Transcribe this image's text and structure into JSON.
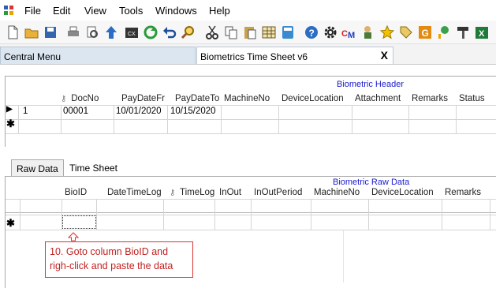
{
  "menu": [
    "File",
    "Edit",
    "View",
    "Tools",
    "Windows",
    "Help"
  ],
  "toolbar_icons": [
    "new-document-icon",
    "open-folder-icon",
    "save-icon",
    "print-icon",
    "print-preview-icon",
    "upload-icon",
    "console-icon",
    "refresh-icon",
    "undo-icon",
    "search-tool-icon",
    "cut-icon",
    "copy-icon",
    "paste-icon",
    "grid-icon",
    "calculator-icon",
    "help-icon",
    "settings-icon",
    "cm-icon",
    "user-icon",
    "star-icon",
    "tag-icon",
    "g-icon",
    "chart-icon",
    "brush-icon",
    "excel-icon"
  ],
  "doc_tabs": {
    "central": "Central Menu",
    "biometrics": "Biometrics Time Sheet v6",
    "close": "X"
  },
  "header_grid": {
    "caption": "Biometric Header",
    "columns": [
      "DocNo",
      "PayDateFr",
      "PayDateTo",
      "MachineNo",
      "DeviceLocation",
      "Attachment",
      "Remarks",
      "Status"
    ],
    "rows": [
      {
        "num": "1",
        "docno": "00001",
        "paydatefr": "10/01/2020",
        "paydateto": "10/15/2020"
      }
    ]
  },
  "sub_tabs": {
    "raw": "Raw Data",
    "time": "Time Sheet"
  },
  "raw_grid": {
    "caption": "Biometric Raw Data",
    "columns": [
      "BioID",
      "DateTimeLog",
      "TimeLog",
      "InOut",
      "InOutPeriod",
      "MachineNo",
      "DeviceLocation",
      "Remarks"
    ]
  },
  "callout": {
    "line1": "10. Goto column BioID and",
    "line2": "righ-click and paste the data"
  },
  "markers": {
    "current": "▶",
    "new": "✱"
  }
}
